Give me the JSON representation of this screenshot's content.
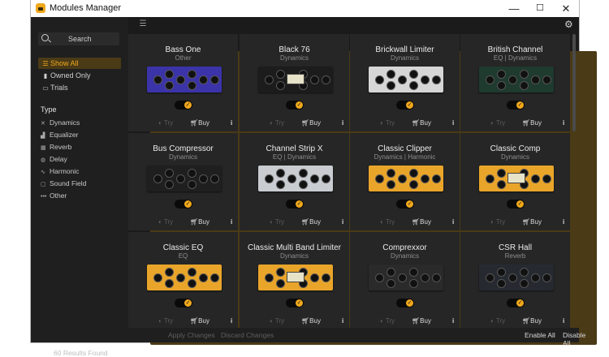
{
  "window": {
    "title": "Modules Manager",
    "minimize_glyph": "—",
    "maximize_glyph": "☐",
    "close_glyph": "✕"
  },
  "accent_color": "#f0a81c",
  "sidebar": {
    "search_placeholder": "Search",
    "filters": [
      {
        "label": "Show All",
        "icon": "list-icon",
        "selected": true
      },
      {
        "label": "Owned Only",
        "icon": "bookmark-icon",
        "selected": false
      },
      {
        "label": "Trials",
        "icon": "calendar-icon",
        "selected": false
      }
    ],
    "type_heading": "Type",
    "types": [
      {
        "label": "Dynamics",
        "icon": "compress-icon"
      },
      {
        "label": "Equalizer",
        "icon": "equalizer-icon"
      },
      {
        "label": "Reverb",
        "icon": "reverb-icon"
      },
      {
        "label": "Delay",
        "icon": "delay-icon"
      },
      {
        "label": "Harmonic",
        "icon": "harmonic-icon"
      },
      {
        "label": "Sound Field",
        "icon": "soundfield-icon"
      },
      {
        "label": "Other",
        "icon": "more-icon"
      }
    ],
    "results": "60 Results Found"
  },
  "modules": [
    {
      "name": "Bass One",
      "category": "Other",
      "color": "#3b33a8"
    },
    {
      "name": "Black 76",
      "category": "Dynamics",
      "color": "#1c1c1c"
    },
    {
      "name": "Brickwall Limiter",
      "category": "Dynamics",
      "color": "#d6d6d6"
    },
    {
      "name": "British Channel",
      "category": "EQ | Dynamics",
      "color": "#1f3a2f"
    },
    {
      "name": "Bus Compressor",
      "category": "Dynamics",
      "color": "#1f1f1f"
    },
    {
      "name": "Channel Strip X",
      "category": "EQ | Dynamics",
      "color": "#c9ccd0"
    },
    {
      "name": "Classic Clipper",
      "category": "Dynamics | Harmonic",
      "color": "#e9a52a"
    },
    {
      "name": "Classic Comp",
      "category": "Dynamics",
      "color": "#e9a52a"
    },
    {
      "name": "Classic EQ",
      "category": "EQ",
      "color": "#e9a52a"
    },
    {
      "name": "Classic Multi Band Limiter",
      "category": "Dynamics",
      "color": "#e9a52a"
    },
    {
      "name": "Comprexxor",
      "category": "Dynamics",
      "color": "#2a2a2a"
    },
    {
      "name": "CSR Hall",
      "category": "Reverb",
      "color": "#262a30"
    }
  ],
  "card_actions": {
    "try": "Try",
    "buy": "Buy",
    "info": "i",
    "check": "✓"
  },
  "footer": {
    "apply": "Apply Changes",
    "discard": "Discard Changes",
    "enable_all": "Enable All",
    "disable_all": "Disable All"
  }
}
